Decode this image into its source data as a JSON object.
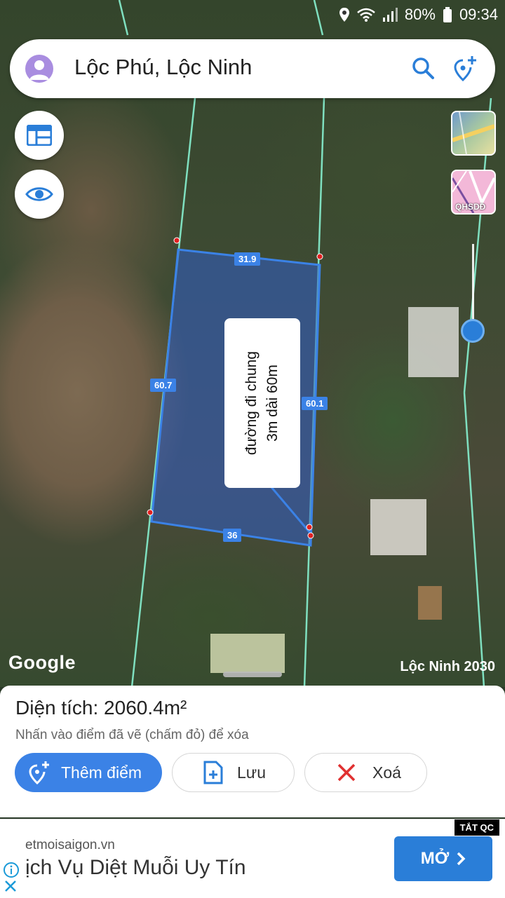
{
  "status": {
    "battery": "80%",
    "time": "09:34"
  },
  "search": {
    "title": "Lộc Phú, Lộc Ninh"
  },
  "map": {
    "edges": {
      "top": "31.9",
      "left": "60.7",
      "right": "60.1",
      "bottom": "36"
    },
    "note_line1": "đường đi chung",
    "note_line2": "3m dài 60m",
    "layer_badge": "QHSDĐ",
    "google_logo": "Google",
    "caption": "Lộc Ninh 2030"
  },
  "panel": {
    "area": "Diện tích: 2060.4m²",
    "hint": "Nhấn vào điểm đã vẽ (chấm đỏ) để xóa",
    "add_point": "Thêm điểm",
    "save": "Lưu",
    "delete": "Xoá"
  },
  "ad": {
    "domain": "etmoisaigon.vn",
    "title": "ịch Vụ Diệt Muỗi Uy Tín",
    "open_button": "MỞ",
    "badge": "TẮT QC"
  },
  "colors": {
    "accent": "#3b82e6",
    "polygon_fill": "#2f5ec8",
    "boundary": "#7fe0c0",
    "vertex": "#e02020"
  }
}
